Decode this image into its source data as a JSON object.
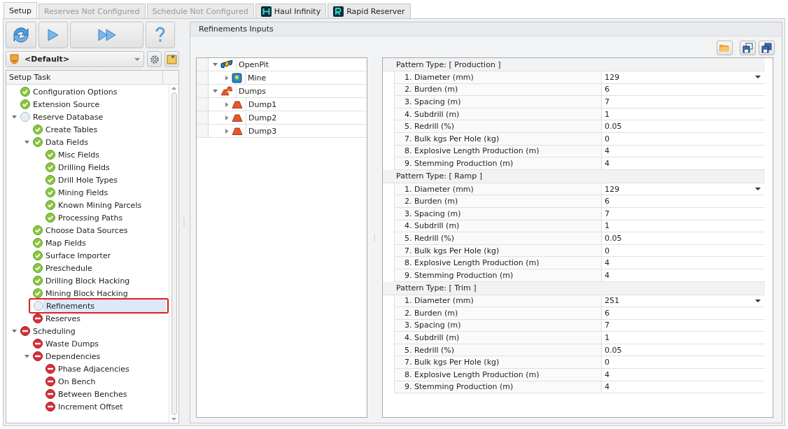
{
  "tabs": [
    {
      "label": "Setup",
      "selected": true,
      "disabled": false
    },
    {
      "label": "Reserves Not Configured",
      "selected": false,
      "disabled": true
    },
    {
      "label": "Schedule Not Configured",
      "selected": false,
      "disabled": true
    },
    {
      "label": "Haul Infinity",
      "selected": false,
      "disabled": false,
      "kind": "haul"
    },
    {
      "label": "Rapid Reserver",
      "selected": false,
      "disabled": false,
      "kind": "rapid"
    }
  ],
  "profile": {
    "value": "<Default>"
  },
  "setup_tree": {
    "heading": "Setup Task",
    "items": [
      {
        "label": "Configuration Options",
        "kind": "done",
        "selected": false
      },
      {
        "label": "Extension Source",
        "kind": "done",
        "selected": false
      },
      {
        "label": "Reserve Database",
        "kind": "pending",
        "selected": false,
        "expanded": true,
        "children": [
          {
            "label": "Create Tables",
            "kind": "done",
            "selected": false
          },
          {
            "label": "Data Fields",
            "kind": "done",
            "selected": false,
            "expanded": true,
            "children": [
              {
                "label": "Misc Fields",
                "kind": "done",
                "selected": false
              },
              {
                "label": "Drilling Fields",
                "kind": "done",
                "selected": false
              },
              {
                "label": "Drill Hole Types",
                "kind": "done",
                "selected": false
              },
              {
                "label": "Mining Fields",
                "kind": "done",
                "selected": false
              },
              {
                "label": "Known Mining Parcels",
                "kind": "done",
                "selected": false
              },
              {
                "label": "Processing Paths",
                "kind": "done",
                "selected": false
              }
            ]
          },
          {
            "label": "Choose Data Sources",
            "kind": "done",
            "selected": false
          },
          {
            "label": "Map Fields",
            "kind": "done",
            "selected": false
          },
          {
            "label": "Surface Importer",
            "kind": "done",
            "selected": false
          },
          {
            "label": "Preschedule",
            "kind": "done",
            "selected": false
          },
          {
            "label": "Drilling Block Hacking",
            "kind": "done",
            "selected": false
          },
          {
            "label": "Mining Block Hacking",
            "kind": "done",
            "selected": false
          },
          {
            "label": "Refinements",
            "kind": "pending",
            "selected": true
          },
          {
            "label": "Reserves",
            "kind": "error",
            "selected": false
          }
        ]
      },
      {
        "label": "Scheduling",
        "kind": "error",
        "selected": false,
        "expanded": true,
        "children": [
          {
            "label": "Waste Dumps",
            "kind": "error",
            "selected": false
          },
          {
            "label": "Dependencies",
            "kind": "error",
            "selected": false,
            "expanded": true,
            "children": [
              {
                "label": "Phase Adjacencies",
                "kind": "error",
                "selected": false
              },
              {
                "label": "On Bench",
                "kind": "error",
                "selected": false
              },
              {
                "label": "Between Benches",
                "kind": "error",
                "selected": false
              },
              {
                "label": "Increment Offset",
                "kind": "error",
                "selected": false
              }
            ]
          }
        ]
      }
    ]
  },
  "panel": {
    "title": "Refinements Inputs"
  },
  "location_tree": [
    {
      "label": "OpenPit",
      "kind": "pit",
      "expanded": true,
      "children": [
        {
          "label": "Mine",
          "kind": "mine",
          "expanded": false
        }
      ]
    },
    {
      "label": "Dumps",
      "kind": "dumps",
      "expanded": true,
      "children": [
        {
          "label": "Dump1",
          "kind": "dump",
          "expanded": false
        },
        {
          "label": "Dump2",
          "kind": "dump",
          "expanded": false
        },
        {
          "label": "Dump3",
          "kind": "dump",
          "expanded": false
        }
      ]
    }
  ],
  "patterns": [
    {
      "heading": "Pattern Type: [ Production ]",
      "rows": [
        [
          "1. Diameter (mm)",
          "129"
        ],
        [
          "2. Burden (m)",
          "6"
        ],
        [
          "3. Spacing (m)",
          "7"
        ],
        [
          "4. Subdrill (m)",
          "1"
        ],
        [
          "5. Redrill (%)",
          "0.05"
        ],
        [
          "7. Bulk kgs Per Hole (kg)",
          "0"
        ],
        [
          "8. Explosive Length Production (m)",
          "4"
        ],
        [
          "9. Stemming Production (m)",
          "4"
        ]
      ]
    },
    {
      "heading": "Pattern Type: [ Ramp ]",
      "rows": [
        [
          "1. Diameter (mm)",
          "129"
        ],
        [
          "2. Burden (m)",
          "6"
        ],
        [
          "3. Spacing (m)",
          "7"
        ],
        [
          "4. Subdrill (m)",
          "1"
        ],
        [
          "5. Redrill (%)",
          "0.05"
        ],
        [
          "7. Bulk kgs Per Hole (kg)",
          "0"
        ],
        [
          "8. Explosive Length Production (m)",
          "4"
        ],
        [
          "9. Stemming Production (m)",
          "4"
        ]
      ]
    },
    {
      "heading": "Pattern Type: [ Trim ]",
      "rows": [
        [
          "1. Diameter (mm)",
          "251"
        ],
        [
          "2. Burden (m)",
          "6"
        ],
        [
          "3. Spacing (m)",
          "7"
        ],
        [
          "4. Subdrill (m)",
          "1"
        ],
        [
          "5. Redrill (%)",
          "0.05"
        ],
        [
          "7. Bulk kgs Per Hole (kg)",
          "0"
        ],
        [
          "8. Explosive Length Production (m)",
          "4"
        ],
        [
          "9. Stemming Production (m)",
          "4"
        ]
      ]
    }
  ]
}
